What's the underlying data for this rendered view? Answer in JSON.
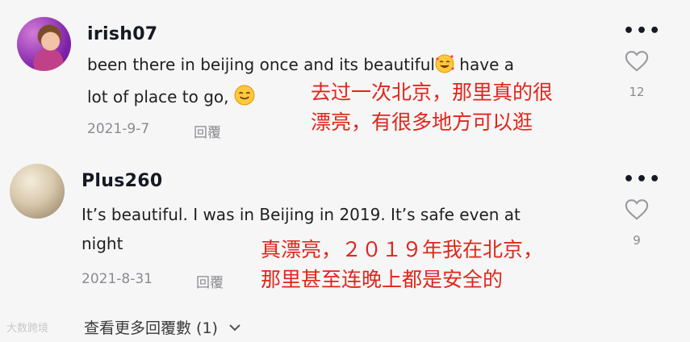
{
  "comments": [
    {
      "username": "irish07",
      "text_line1": "been there in beijing once and its beautiful",
      "text_line1b": " have a",
      "text_line2": "lot of place to go, ",
      "date": "2021-9-7",
      "reply_label": "回覆",
      "likes": "12",
      "more_label": "•••",
      "overlay_line1": "去过一次北京，那里真的很",
      "overlay_line2": "漂亮，有很多地方可以逛"
    },
    {
      "username": "Plus260",
      "text_line1": "It’s beautiful. I was in Beijing in 2019. It’s safe even at",
      "text_line2": "night",
      "date": "2021-8-31",
      "reply_label": "回覆",
      "likes": "9",
      "more_label": "•••",
      "overlay_line1": "真漂亮，２０１９年我在北京，",
      "overlay_line2": "那里甚至连晚上都是安全的"
    }
  ],
  "view_more": "查看更多回覆數 (1)",
  "watermark": "大数跨境",
  "icons": [
    "heart-icon",
    "more-icon",
    "chevron-down-icon",
    "smiling-face-with-hearts-emoji",
    "smiling-face-emoji"
  ]
}
